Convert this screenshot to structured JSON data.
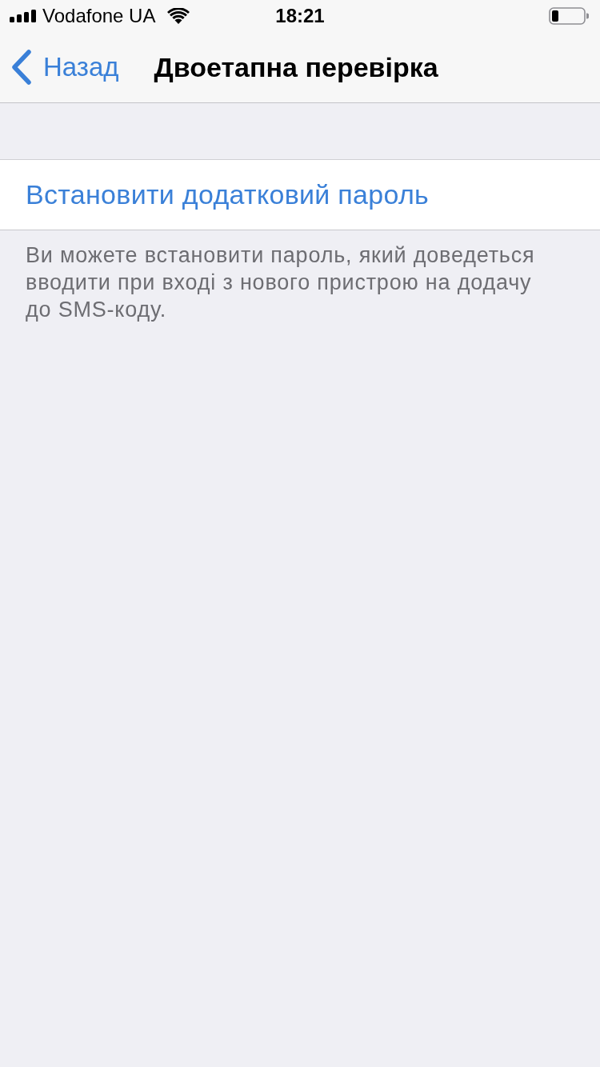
{
  "status_bar": {
    "carrier": "Vodafone UA",
    "time": "18:21"
  },
  "nav_bar": {
    "back_label": "Назад",
    "title": "Двоетапна перевірка"
  },
  "section": {
    "items": [
      {
        "label": "Встановити додатковий пароль"
      }
    ],
    "footer": "Ви можете встановити пароль, який доведеться вводити при вході з нового пристрою на додачу до SMS-коду."
  }
}
